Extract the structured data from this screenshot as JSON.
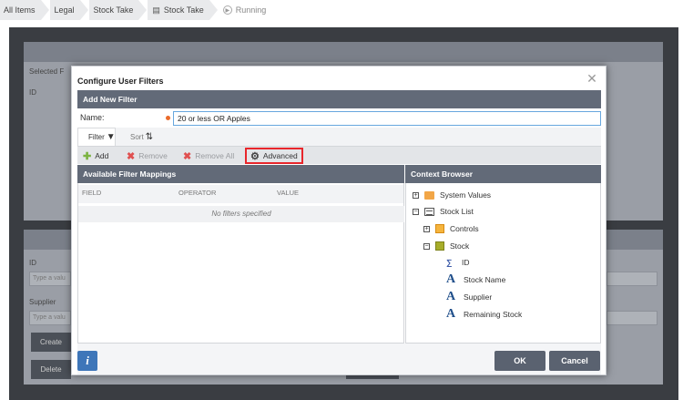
{
  "breadcrumb": {
    "items": [
      "All Items",
      "Legal",
      "Stock Take",
      "Stock Take"
    ],
    "running": "Running"
  },
  "background": {
    "selected_label": "Selected F",
    "id_col": "ID",
    "id_label": "ID",
    "supplier_label": "Supplier",
    "placeholder": "Type a valu",
    "create_btn": "Create",
    "delete_btn": "Delete"
  },
  "modal": {
    "title": "Configure User Filters",
    "add_new_filter": "Add New Filter",
    "name_label": "Name:",
    "name_value": "20 or less OR Apples",
    "tabs": {
      "filter": "Filter",
      "sort": "Sort"
    },
    "toolbar": {
      "add": "Add",
      "remove": "Remove",
      "remove_all": "Remove All",
      "advanced": "Advanced"
    },
    "mappings": {
      "title": "Available Filter Mappings",
      "columns": [
        "FIELD",
        "OPERATOR",
        "VALUE"
      ],
      "empty": "No filters specified"
    },
    "context": {
      "title": "Context Browser",
      "system_values": "System Values",
      "stock_list": "Stock List",
      "controls": "Controls",
      "stock": "Stock",
      "fields": [
        "ID",
        "Stock Name",
        "Supplier",
        "Remaining Stock"
      ]
    },
    "footer": {
      "info": "i",
      "ok": "OK",
      "cancel": "Cancel"
    }
  },
  "colors": {
    "header_bg": "#626a78",
    "advanced_highlight": "#e8262b",
    "required_dot": "#ea6b2b",
    "info_button": "#3e76b9"
  }
}
